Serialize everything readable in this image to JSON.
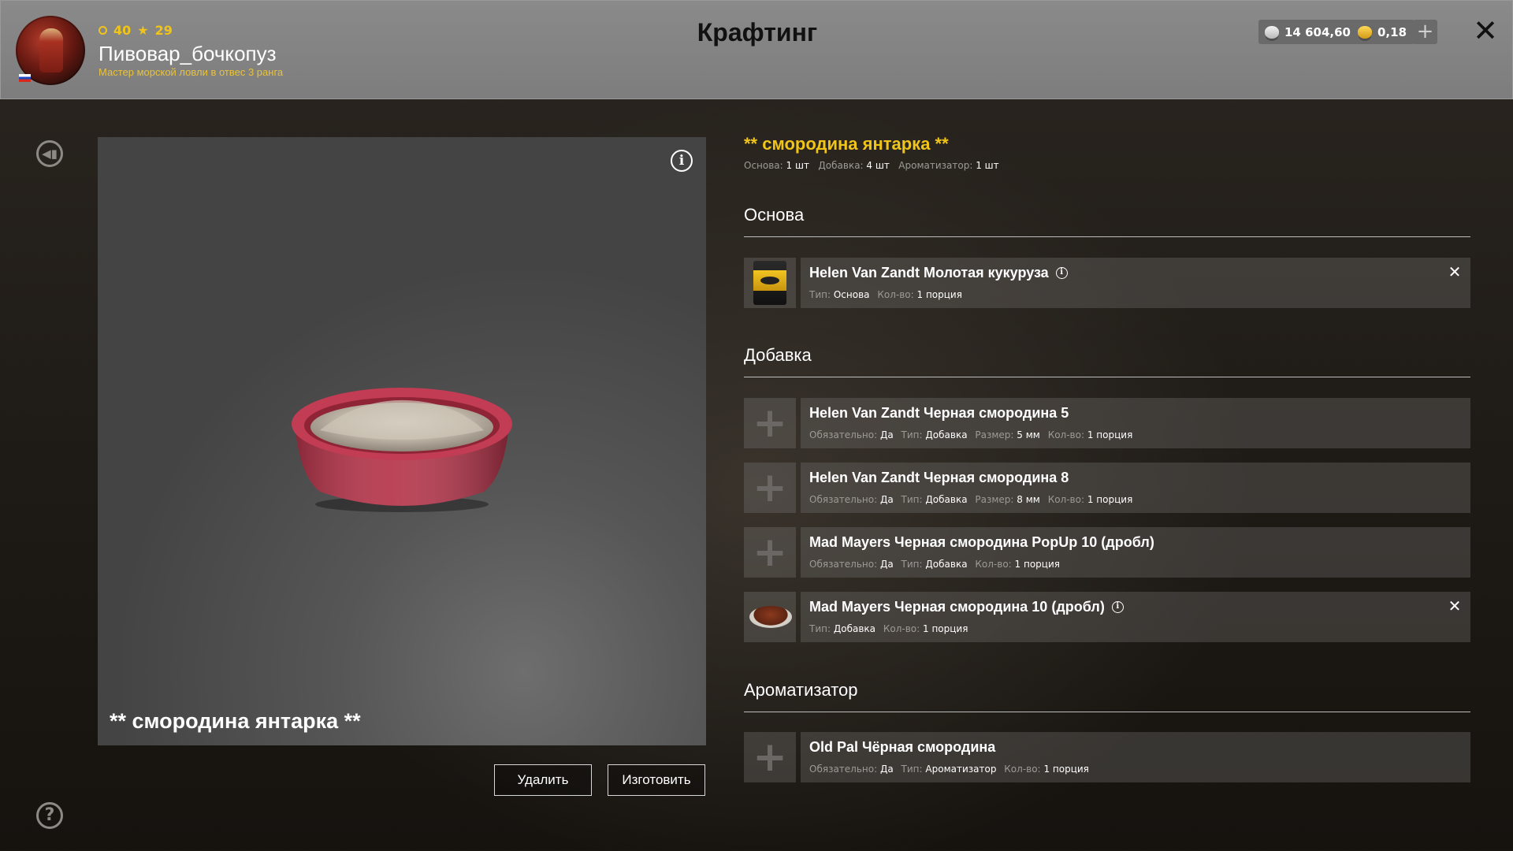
{
  "header": {
    "title": "Крафтинг",
    "player": {
      "level": "40",
      "stars": "29",
      "username": "Пивовар_бочкопуз",
      "rank": "Мастер морской ловли в отвес 3 ранга"
    },
    "currency": {
      "silver": "14 604,60",
      "gold": "0,18"
    }
  },
  "preview": {
    "item_name": "** смородина янтарка **",
    "delete_label": "Удалить",
    "craft_label": "Изготовить"
  },
  "recipe": {
    "title": "** смородина янтарка **",
    "summary": [
      {
        "label": "Основа:",
        "value": "1 шт"
      },
      {
        "label": "Добавка:",
        "value": "4 шт"
      },
      {
        "label": "Ароматизатор:",
        "value": "1 шт"
      }
    ],
    "sections": {
      "base": "Основа",
      "additive": "Добавка",
      "flavor": "Ароматизатор"
    },
    "base_items": [
      {
        "name": "Helen Van Zandt Молотая кукуруза",
        "meta": [
          {
            "label": "Тип:",
            "value": "Основа"
          },
          {
            "label": "Кол-во:",
            "value": "1 порция"
          }
        ]
      }
    ],
    "additive_items": [
      {
        "name": "Helen Van Zandt Черная смородина 5",
        "meta": [
          {
            "label": "Обязательно:",
            "value": "Да"
          },
          {
            "label": "Тип:",
            "value": "Добавка"
          },
          {
            "label": "Размер:",
            "value": "5 мм"
          },
          {
            "label": "Кол-во:",
            "value": "1 порция"
          }
        ]
      },
      {
        "name": "Helen Van Zandt Черная смородина 8",
        "meta": [
          {
            "label": "Обязательно:",
            "value": "Да"
          },
          {
            "label": "Тип:",
            "value": "Добавка"
          },
          {
            "label": "Размер:",
            "value": "8 мм"
          },
          {
            "label": "Кол-во:",
            "value": "1 порция"
          }
        ]
      },
      {
        "name": "Mad Mayers Черная смородина PopUp 10 (дробл)",
        "meta": [
          {
            "label": "Обязательно:",
            "value": "Да"
          },
          {
            "label": "Тип:",
            "value": "Добавка"
          },
          {
            "label": "Кол-во:",
            "value": "1 порция"
          }
        ]
      },
      {
        "name": "Mad Mayers Черная смородина 10 (дробл)",
        "meta": [
          {
            "label": "Тип:",
            "value": "Добавка"
          },
          {
            "label": "Кол-во:",
            "value": "1 порция"
          }
        ]
      }
    ],
    "flavor_items": [
      {
        "name": "Old Pal Чёрная смородина",
        "meta": [
          {
            "label": "Обязательно:",
            "value": "Да"
          },
          {
            "label": "Тип:",
            "value": "Ароматизатор"
          },
          {
            "label": "Кол-во:",
            "value": "1 порция"
          }
        ]
      }
    ]
  }
}
